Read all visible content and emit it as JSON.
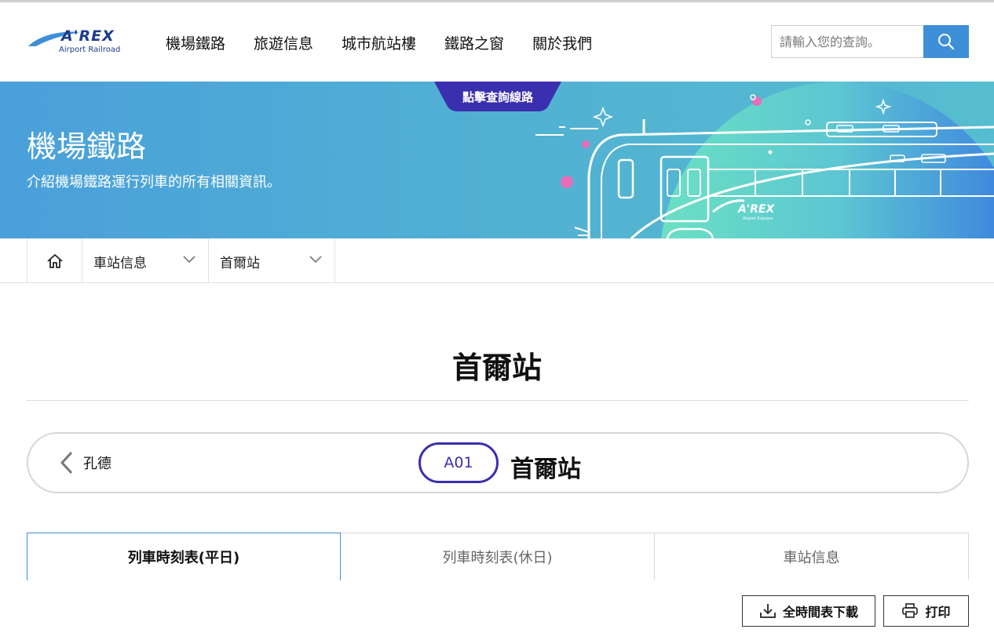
{
  "logo": {
    "word": "A'REX",
    "sub": "Airport Railroad"
  },
  "nav": {
    "items": [
      "機場鐵路",
      "旅遊信息",
      "城市航站樓",
      "鐵路之窗",
      "關於我們"
    ]
  },
  "search": {
    "placeholder": "請輸入您的查詢。",
    "icon": "search-icon"
  },
  "banner": {
    "title": "機場鐵路",
    "description": "介紹機場鐵路運行列車的所有相關資訊。",
    "route_tab": "點擊查詢線路",
    "train_brand": "A'REX",
    "train_sub": "Airport Express"
  },
  "breadcrumb": {
    "home_icon": "home-icon",
    "level1": "車站信息",
    "level2": "首爾站"
  },
  "page": {
    "title": "首爾站"
  },
  "station": {
    "prev": "孔德",
    "code": "A01",
    "name": "首爾站"
  },
  "tabs": [
    "列車時刻表(平日)",
    "列車時刻表(休日)",
    "車站信息"
  ],
  "actions": {
    "download": "全時間表下載",
    "print": "打印"
  },
  "colors": {
    "accent": "#3e8fd8",
    "code_ring": "#3a2fae",
    "route_tab": "#3a2fae"
  }
}
